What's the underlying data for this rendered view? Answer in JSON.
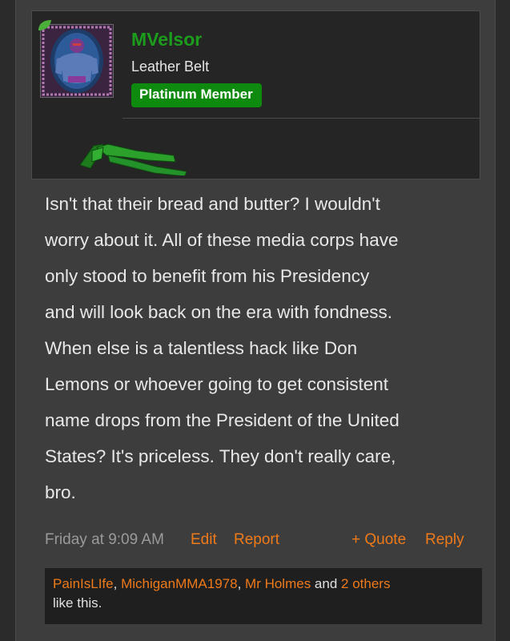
{
  "user": {
    "name": "MVelsor",
    "title": "Leather Belt",
    "banner": "Platinum Member"
  },
  "post": {
    "message": "Isn't that their bread and butter? I wouldn't\nworry about it. All of these media corps have\nonly stood to benefit from his Presidency\nand will look back on the era with fondness.\nWhen else is a talentless hack like Don\nLemons or whoever going to get consistent\nname drops from the President of the United\nStates? It's priceless. They don't really care,\nbro.",
    "timestamp": "Friday at 9:09 AM",
    "edit_label": "Edit",
    "report_label": "Report",
    "quote_label": "+ Quote",
    "reply_label": "Reply"
  },
  "likes": {
    "users": [
      "PainIsLIfe",
      "MichiganMMA1978",
      "Mr Holmes"
    ],
    "sep1": ", ",
    "sep2": ", ",
    "and_text": " and ",
    "others_label": "2 others",
    "suffix": "like this."
  },
  "colors": {
    "username": "#1c9c1c",
    "banner_bg": "#0e8a0e",
    "link": "#ee7a1a",
    "background": "#3d3d3d"
  },
  "icons": {
    "avatar": "user-avatar-image",
    "leaf": "leaf-icon",
    "trophy": "green-belt-trophy-icon"
  }
}
